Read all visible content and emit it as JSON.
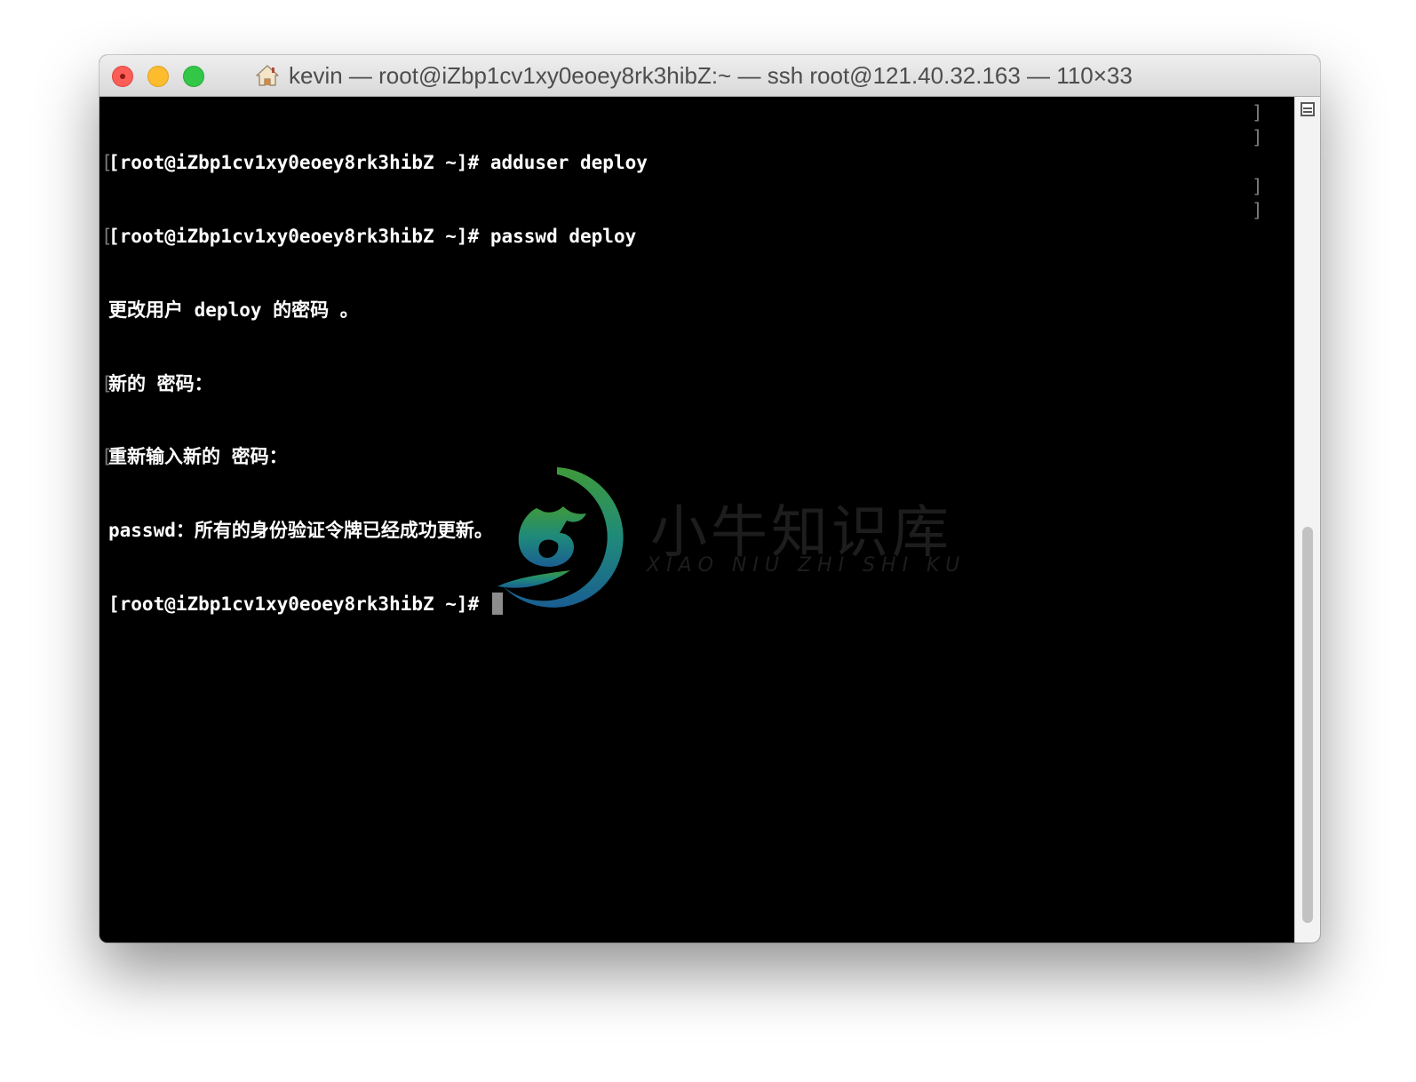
{
  "window": {
    "title": "kevin — root@iZbp1cv1xy0eoey8rk3hibZ:~ — ssh root@121.40.32.163 — 110×33",
    "title_icon": "home-icon",
    "traffic_lights": {
      "close": "#fc5d57",
      "minimize": "#fdbc2e",
      "zoom": "#33c748"
    }
  },
  "terminal": {
    "background": "#000000",
    "foreground": "#ffffff",
    "lines": [
      "[root@iZbp1cv1xy0eoey8rk3hibZ ~]# adduser deploy",
      "[root@iZbp1cv1xy0eoey8rk3hibZ ~]# passwd deploy",
      "更改用户 deploy 的密码 。",
      "新的 密码：",
      "重新输入新的 密码：",
      "passwd：所有的身份验证令牌已经成功更新。",
      "[root@iZbp1cv1xy0eoey8rk3hibZ ~]# "
    ]
  },
  "watermark": {
    "name_cn": "小牛知识库",
    "name_en": "XIAO NIU ZHI SHI KU",
    "logo_icon": "bull-logo-icon"
  },
  "scrollbar": {
    "split_icon": "split-pane-icon"
  }
}
